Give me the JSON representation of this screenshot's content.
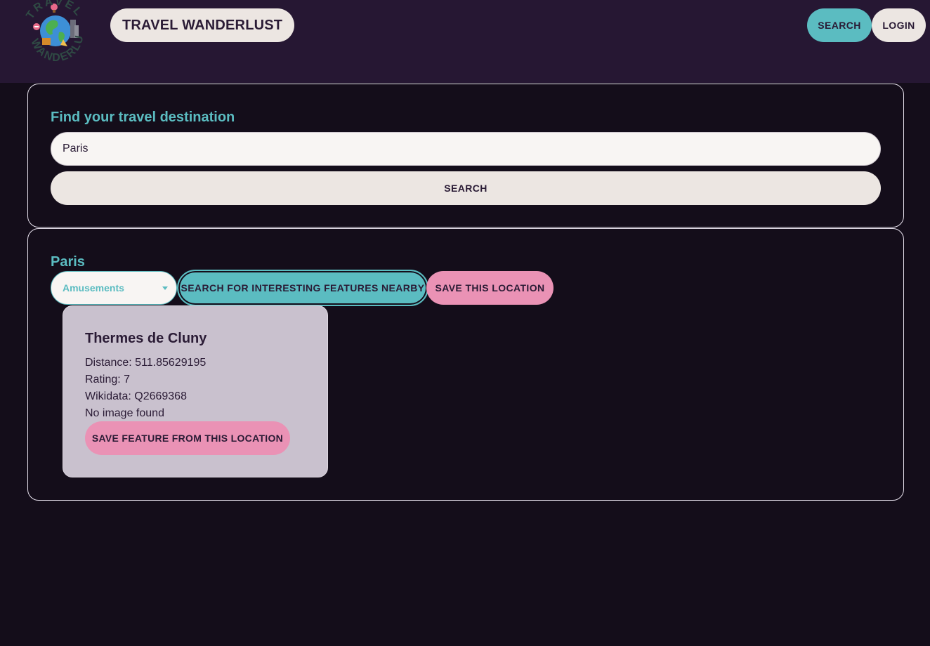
{
  "header": {
    "logo_text": "TRAVEL WANDERLUST",
    "brand": "TRAVEL WANDERLUST",
    "nav": {
      "search_label": "SEARCH",
      "login_label": "LOGIN"
    }
  },
  "search_panel": {
    "heading": "Find your travel destination",
    "input_value": "Paris",
    "search_button_label": "SEARCH"
  },
  "location_panel": {
    "title": "Paris",
    "category_select": {
      "selected": "Amusements"
    },
    "features_button_label": "SEARCH FOR INTERESTING FEATURES NEARBY",
    "save_location_label": "SAVE THIS LOCATION"
  },
  "feature": {
    "name": "Thermes de Cluny",
    "distance": "Distance: 511.85629195",
    "rating": "Rating: 7",
    "wikidata": "Wikidata: Q2669368",
    "image_status": "No image found",
    "save_label": "SAVE FEATURE FROM THIS LOCATION"
  },
  "colors": {
    "background": "#140d1a",
    "header_bg": "#261733",
    "accent_teal": "#5bbcc1",
    "accent_pink": "#ea92b5",
    "card_bg": "#c9c1ce"
  }
}
